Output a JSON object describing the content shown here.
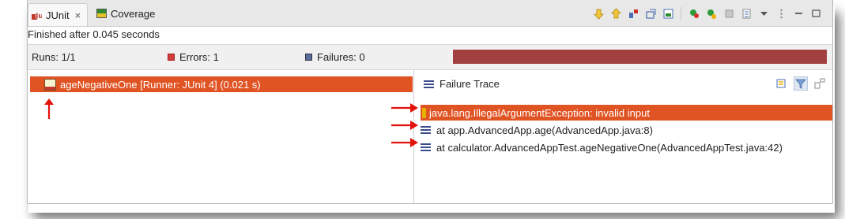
{
  "tabs": [
    {
      "label": "JUnit",
      "close": "×",
      "icon": "junit-icon",
      "active": true
    },
    {
      "label": "Coverage",
      "icon": "coverage-icon",
      "active": false
    }
  ],
  "toolbar": {
    "buttons": [
      "next-failure-icon",
      "previous-failure-icon",
      "relaunch-icon",
      "relaunch-failed-icon",
      "scroll-lock-icon",
      "show-failures-only-icon",
      "test-run-history-icon",
      "stop-icon",
      "layout-icon",
      "view-menu-icon",
      "minimize-icon",
      "maximize-icon"
    ]
  },
  "status": {
    "text": "Finished after 0.045 seconds"
  },
  "counters": {
    "runs": "Runs:  1/1",
    "errors": "Errors:  1",
    "failures": "Failures:  0",
    "progress_color": "#a23f3f",
    "progress_fraction": 1.0
  },
  "tree": {
    "items": [
      {
        "label": "ageNegativeOne [Runner: JUnit 4] (0.021 s)",
        "selected": true,
        "status": "error"
      }
    ]
  },
  "failure_trace": {
    "title": "Failure Trace",
    "lines": [
      {
        "text": "java.lang.IllegalArgumentException: invalid input",
        "selected": true,
        "type": "exception"
      },
      {
        "text": "at app.AdvancedApp.age(AdvancedApp.java:8)",
        "selected": false,
        "type": "frame"
      },
      {
        "text": "at calculator.AdvancedAppTest.ageNegativeOne(AdvancedAppTest.java:42)",
        "selected": false,
        "type": "frame"
      }
    ]
  },
  "colors": {
    "selection": "#e05323",
    "annotation_arrow": "#e3120b",
    "tab_bar": "#e8e8e8"
  }
}
